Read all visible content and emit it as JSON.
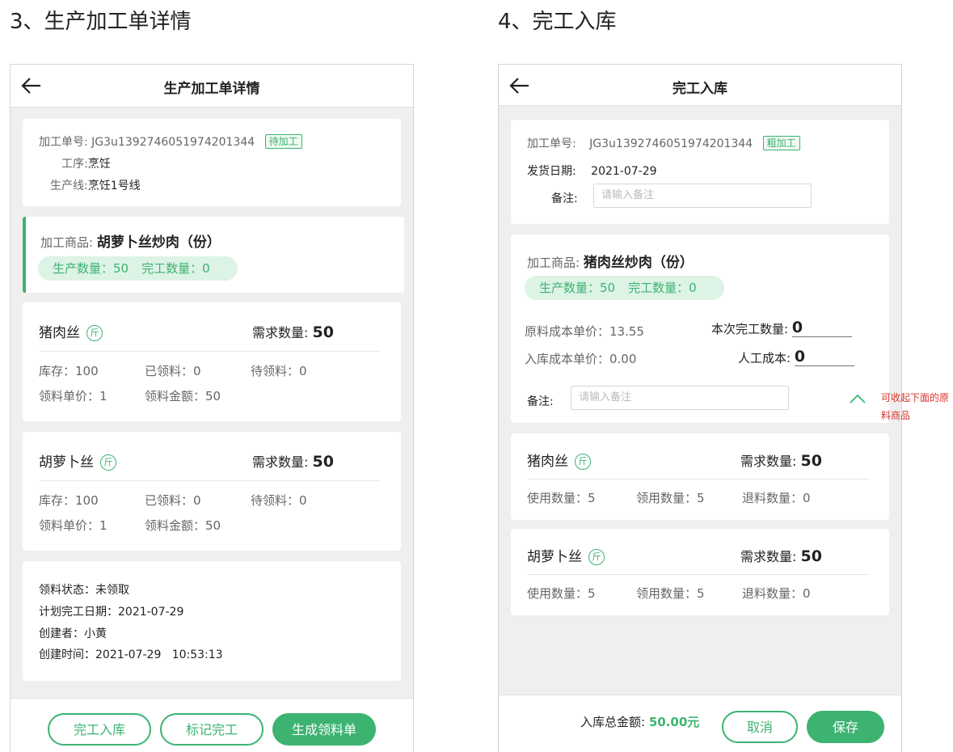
{
  "colors": {
    "accent": "#3cb371",
    "annotation": "#d9342b",
    "background": "#efefef"
  },
  "left": {
    "section_title": "3、生产加工单详情",
    "nav_title": "生产加工单详情",
    "back_icon": "arrow-left-icon",
    "order": {
      "no_label": "加工单号:",
      "no_value": "JG3u1392746051974201344",
      "status_tag": "待加工",
      "process_label": "工序:",
      "process_value": "烹饪",
      "line_label": "生产线:",
      "line_value": "烹饪1号线"
    },
    "product": {
      "label": "加工商品:",
      "name": "胡萝卜丝炒肉（份）",
      "produce_qty": "生产数量：50",
      "done_qty": "完工数量：0"
    },
    "materials": [
      {
        "name": "猪肉丝",
        "unit": "斤",
        "demand_label": "需求数量:",
        "demand_value": "50",
        "stock": "库存：100",
        "picked": "已领料：0",
        "pending": "待领料：0",
        "unit_price": "领料单价：1",
        "amount": "领料金额：50"
      },
      {
        "name": "胡萝卜丝",
        "unit": "斤",
        "demand_label": "需求数量:",
        "demand_value": "50",
        "stock": "库存：100",
        "picked": "已领料：0",
        "pending": "待领料：0",
        "unit_price": "领料单价：1",
        "amount": "领料金额：50"
      }
    ],
    "info": {
      "status": "领料状态：未领取",
      "plan_date": "计划完工日期：2021-07-29",
      "creator": "创建者：小黄",
      "created": "创建时间：2021-07-29   10:53:13"
    },
    "buttons": {
      "finish_in": "完工入库",
      "mark_done": "标记完工",
      "gen_pick": "生成领料单"
    }
  },
  "right": {
    "section_title": "4、完工入库",
    "nav_title": "完工入库",
    "back_icon": "arrow-left-icon",
    "order": {
      "no_label": "加工单号:",
      "no_value": "JG3u1392746051974201344",
      "tag": "粗加工",
      "ship_label": "发货日期:",
      "ship_value": "2021-07-29",
      "remark_label": "备注:",
      "remark_placeholder": "请输入备注"
    },
    "product": {
      "label": "加工商品:",
      "name": "猪肉丝炒肉（份）",
      "produce_qty": "生产数量：50",
      "done_qty": "完工数量：0",
      "raw_cost": "原料成本单价：13.55",
      "in_cost": "入库成本单价：0.00",
      "this_done_label": "本次完工数量:",
      "this_done_value": "0",
      "labor_label": "人工成本:",
      "labor_value": "0",
      "remark_label": "备注:",
      "remark_placeholder": "请输入备注",
      "collapse_icon": "chevron-up-icon"
    },
    "annotation": "可收起下面的原料商品",
    "materials": [
      {
        "name": "猪肉丝",
        "unit": "斤",
        "demand_label": "需求数量:",
        "demand_value": "50",
        "used": "使用数量：5",
        "picked": "领用数量：5",
        "returned": "退料数量：0"
      },
      {
        "name": "胡萝卜丝",
        "unit": "斤",
        "demand_label": "需求数量:",
        "demand_value": "50",
        "used": "使用数量：5",
        "picked": "领用数量：5",
        "returned": "退料数量：0"
      }
    ],
    "footer": {
      "total_label": "入库总金额:",
      "total_value": "50.00元",
      "cancel": "取消",
      "save": "保存"
    }
  }
}
